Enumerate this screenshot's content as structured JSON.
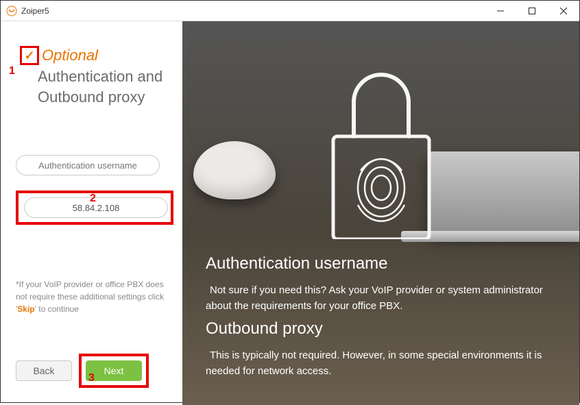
{
  "window": {
    "title": "Zoiper5"
  },
  "left": {
    "optional_checked": true,
    "optional_label": "Optional",
    "subtitle_line1": "Authentication and",
    "subtitle_line2": "Outbound proxy",
    "auth_input": {
      "placeholder": "Authentication username",
      "value": ""
    },
    "proxy_input": {
      "value": "58.84.2.108"
    },
    "note_prefix": "*If your VoIP provider or office PBX does not require these additional settings click '",
    "note_skip": "Skip",
    "note_suffix": "' to continue",
    "back_label": "Back",
    "next_label": "Next"
  },
  "right": {
    "heading1": "Authentication username",
    "para1": "Not sure if you need this? Ask your VoIP provider or system administrator about the requirements for your office PBX.",
    "heading2": "Outbound proxy",
    "para2": "This is typically not required. However, in some special environments it is needed for network access."
  },
  "markers": {
    "m1": "1",
    "m2": "2",
    "m3": "3"
  }
}
